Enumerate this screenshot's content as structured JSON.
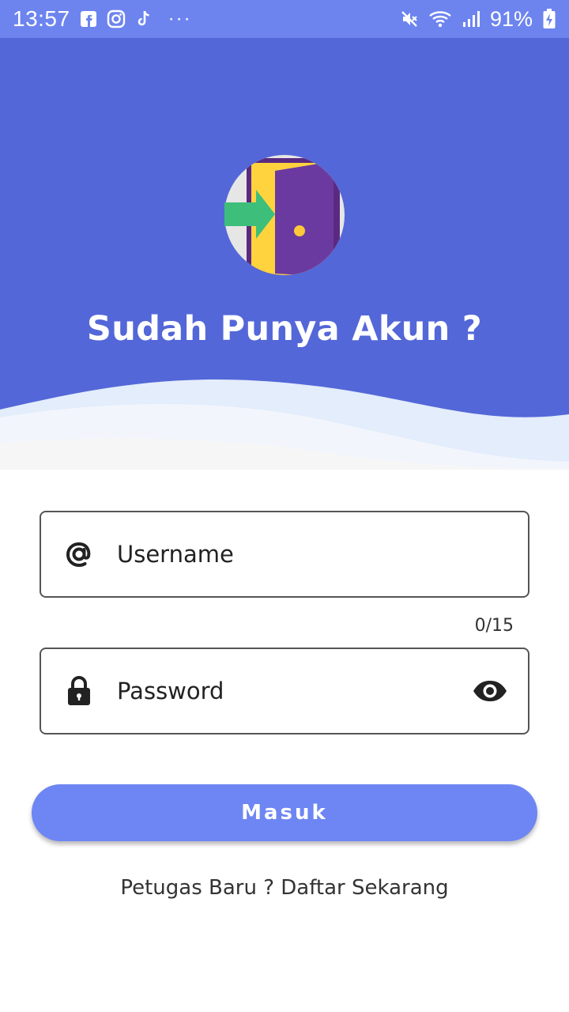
{
  "status_bar": {
    "time": "13:57",
    "more": "···",
    "battery": "91%",
    "left_icons": [
      "facebook-icon",
      "instagram-icon",
      "tiktok-icon"
    ],
    "right_icons": [
      "mute-icon",
      "wifi-icon",
      "signal-icon",
      "battery-charging-icon"
    ]
  },
  "header": {
    "title": "Sudah Punya Akun ?",
    "logo_icon": "door-enter-icon"
  },
  "form": {
    "username_placeholder": "Username",
    "username_counter": "0/15",
    "password_placeholder": "Password",
    "username_icon": "at-icon",
    "password_icon": "lock-icon",
    "visibility_icon": "eye-icon"
  },
  "actions": {
    "login_label": "Masuk",
    "register_link": "Petugas Baru ? Daftar Sekarang"
  },
  "colors": {
    "status_bar": "#6d84ef",
    "header": "#5467d8",
    "button": "#6e86f3",
    "wave_light": "#e2edfb"
  }
}
